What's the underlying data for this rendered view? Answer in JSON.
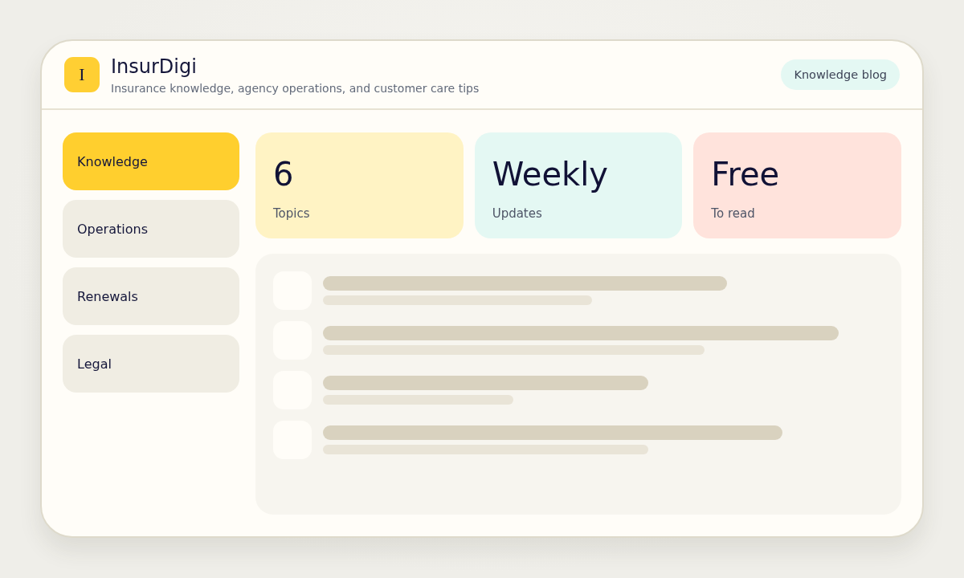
{
  "header": {
    "logo_letter": "I",
    "title": "InsurDigi",
    "tagline": "Insurance knowledge, agency operations, and customer care tips",
    "link": "Knowledge blog"
  },
  "sidebar": {
    "items": [
      {
        "label": "Knowledge",
        "selected": true
      },
      {
        "label": "Operations",
        "selected": false
      },
      {
        "label": "Renewals",
        "selected": false
      },
      {
        "label": "Legal",
        "selected": false
      }
    ]
  },
  "stats": [
    {
      "value": "6",
      "label": "Topics",
      "color": "#fff3c4"
    },
    {
      "value": "Weekly",
      "label": "Updates",
      "color": "#e4f8f3"
    },
    {
      "value": "Free",
      "label": "To read",
      "color": "#ffe3dc"
    }
  ]
}
